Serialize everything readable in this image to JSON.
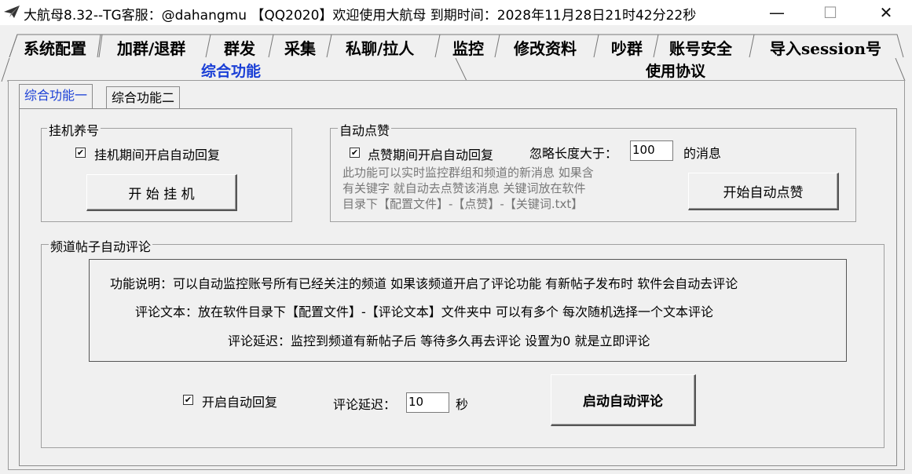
{
  "window": {
    "title": "大航母8.32--TG客服：@dahangmu 【QQ2020】欢迎使用大航母 到期时间：2028年11月28日21时42分22秒",
    "minimize": "—",
    "maximize": "☐",
    "close": "✕"
  },
  "main_tabs": [
    "系统配置",
    "加群/退群",
    "群发",
    "采集",
    "私聊/拉人",
    "监控",
    "修改资料",
    "吵群",
    "账号安全",
    "导入session号"
  ],
  "sub_tabs": {
    "left": "综合功能",
    "right": "使用协议"
  },
  "inner_tabs": [
    "综合功能一",
    "综合功能二"
  ],
  "hangup": {
    "legend": "挂机养号",
    "checkbox_label": "挂机期间开启自动回复",
    "checked": true,
    "button": "开 始 挂 机"
  },
  "autolike": {
    "legend": "自动点赞",
    "checkbox_label": "点赞期间开启自动回复",
    "checked": true,
    "ignore_label": "忽略长度大于：",
    "ignore_value": "100",
    "ignore_suffix": "的消息",
    "desc_lines": [
      "此功能可以实时监控群组和频道的新消息 如果含",
      "有关键字 就自动去点赞该消息  关键词放在软件",
      "目录下【配置文件】-【点赞】-【关键词.txt】"
    ],
    "button": "开始自动点赞"
  },
  "comment": {
    "legend": "频道帖子自动评论",
    "desc_lines": [
      "功能说明：可以自动监控账号所有已经关注的频道 如果该频道开启了评论功能 有新帖子发布时 软件会自动去评论",
      "评论文本：放在软件目录下【配置文件】-【评论文本】文件夹中   可以有多个 每次随机选择一个文本评论",
      "评论延迟：监控到频道有新帖子后 等待多久再去评论 设置为0 就是立即评论"
    ],
    "checkbox_label": "开启自动回复",
    "checked": true,
    "delay_label": "评论延迟：",
    "delay_value": "10",
    "delay_unit": "秒",
    "button": "启动自动评论"
  }
}
